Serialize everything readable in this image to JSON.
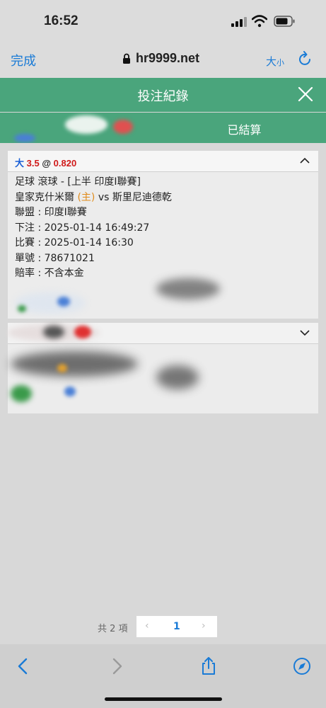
{
  "status": {
    "time": "16:52"
  },
  "browser": {
    "done_label": "完成",
    "url": "hr9999.net",
    "text_size_big": "大",
    "text_size_small": "小"
  },
  "header": {
    "title": "投注紀錄"
  },
  "tabs": {
    "settled": "已結算"
  },
  "bets": [
    {
      "type": "大",
      "handicap": "3.5",
      "at": "@",
      "odds": "0.820",
      "sport_line": "足球 滾球 - [上半 印度I聯賽]",
      "home_team": "皇家克什米爾",
      "home_tag": "(主)",
      "vs": "vs",
      "away_team": "斯里尼迪德乾",
      "league": "聯盟 : 印度I聯賽",
      "placed": "下注 : 2025-01-14 16:49:27",
      "match": "比賽 : 2025-01-14 16:30",
      "ticket": "單號 : 78671021",
      "odds_type": "賠率 : 不含本金"
    }
  ],
  "pagination": {
    "total": "共 2 項",
    "prev": "‹",
    "current": "1",
    "next": "›"
  },
  "colors": {
    "header": "#4aa57c",
    "accent": "#1a7bd6",
    "red": "#d01a1a",
    "orange": "#e08a1a"
  }
}
